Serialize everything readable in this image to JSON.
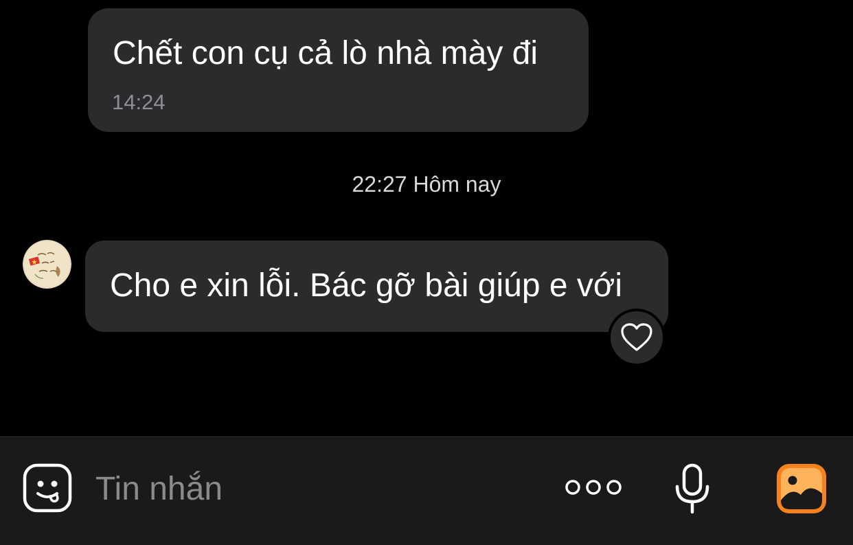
{
  "messages": [
    {
      "text": "Chết con cụ cả lò nhà mày đi",
      "time": "14:24"
    },
    {
      "text": "Cho e xin lỗi. Bác gỡ bài giúp e với"
    }
  ],
  "day_separator": "22:27 Hôm nay",
  "composer": {
    "placeholder": "Tin nhắn",
    "icons": [
      "sticker-icon",
      "more-options-icon",
      "microphone-icon",
      "gallery-icon"
    ]
  },
  "reaction": {
    "icon": "heart-icon"
  },
  "colors": {
    "background": "#000000",
    "bubble": "#2b2b2d",
    "composer_bg": "#1a1a1a",
    "timestamp": "#8e8e93",
    "placeholder": "#8b8b8f",
    "accent_gallery": "#f5821f"
  }
}
